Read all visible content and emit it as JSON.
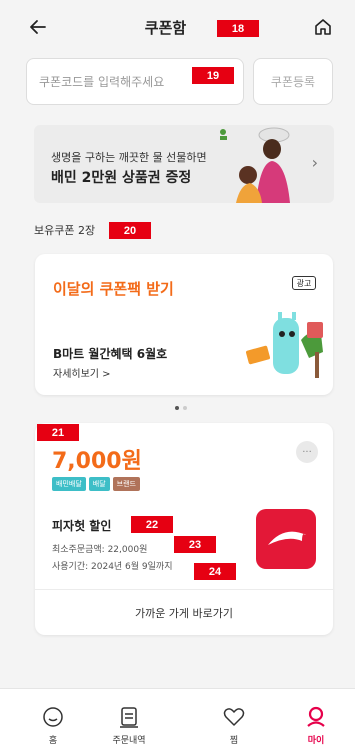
{
  "header": {
    "title": "쿠폰함"
  },
  "coupon_code": {
    "placeholder": "쿠폰코드를 입력해주세요",
    "register_label": "쿠폰등록"
  },
  "banner": {
    "line1": "생명을 구하는 깨끗한 물 선물하면",
    "line2": "배민 2만원 상품권 증정"
  },
  "owned_label": "보유쿠폰 2장",
  "promo_card": {
    "title": "이달의 쿠폰팩 받기",
    "ad_badge": "광고",
    "subtitle": "B마트 월간혜택 6월호",
    "detail_link": "자세히보기 >"
  },
  "coupon": {
    "amount": "7,000원",
    "tags": [
      {
        "label": "배민배달",
        "color": "#3dbec7"
      },
      {
        "label": "배달",
        "color": "#3dbec7"
      },
      {
        "label": "브랜드",
        "color": "#b0735a"
      }
    ],
    "name": "피자헛 할인",
    "min_order": "최소주문금액: 22,000원",
    "period": "사용기간: 2024년 6월 9일까지",
    "nearby_label": "가까운 가게 바로가기"
  },
  "nav": {
    "items": [
      {
        "label": "홈",
        "icon": "home-icon"
      },
      {
        "label": "주문내역",
        "icon": "order-list-icon"
      },
      {
        "label": "찜",
        "icon": "heart-icon"
      },
      {
        "label": "마이",
        "icon": "my-icon"
      }
    ],
    "active_color": "#e6004a"
  },
  "markers": [
    "18",
    "19",
    "20",
    "21",
    "22",
    "23",
    "24"
  ]
}
